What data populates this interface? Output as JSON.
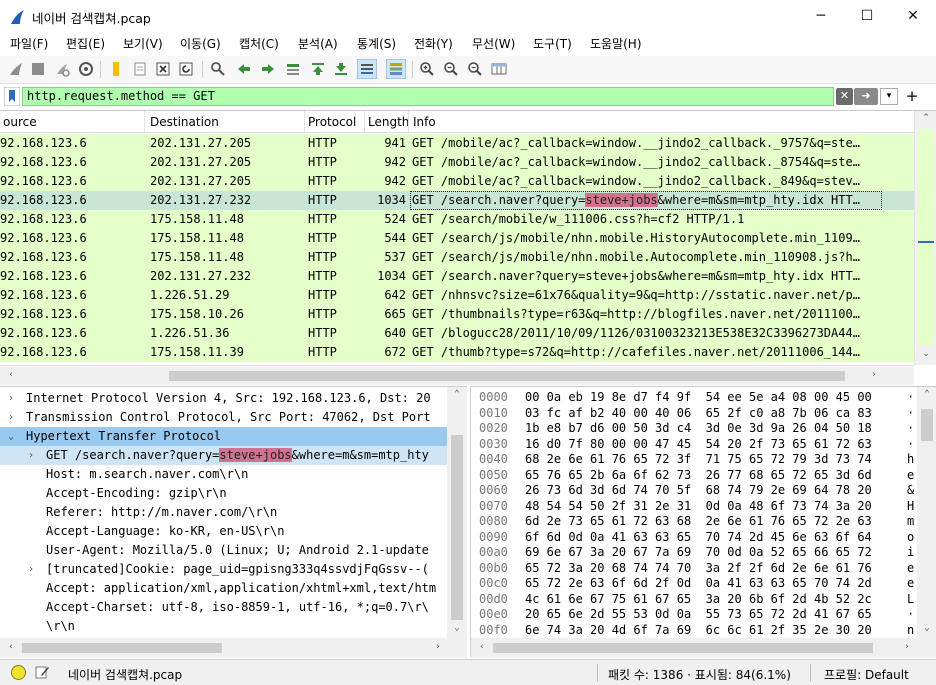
{
  "window": {
    "title": "네이버 검색캡쳐.pcap",
    "minimize_glyph": "─",
    "maximize_glyph": "☐",
    "close_glyph": "✕",
    "icon": "wireshark-fin-icon"
  },
  "menu": [
    "파일(F)",
    "편집(E)",
    "보기(V)",
    "이동(G)",
    "캡처(C)",
    "분석(A)",
    "통계(S)",
    "전화(Y)",
    "무선(W)",
    "도구(T)",
    "도움말(H)"
  ],
  "toolbar_icons": [
    "start-capture-icon",
    "stop-capture-icon",
    "restart-capture-icon",
    "capture-options-icon",
    "open-file-icon",
    "save-file-icon",
    "close-file-icon",
    "reload-file-icon",
    "find-packet-icon",
    "go-back-icon",
    "go-forward-icon",
    "go-to-packet-icon",
    "go-first-icon",
    "go-last-icon",
    "autoscroll-icon",
    "colorize-icon",
    "zoom-in-icon",
    "zoom-out-icon",
    "zoom-normal-icon",
    "resize-columns-icon"
  ],
  "filter": {
    "value": "http.request.method == GET",
    "clear_glyph": "✕",
    "apply_glyph": "➜",
    "dropdown_glyph": "▾",
    "add_glyph": "+"
  },
  "packet_list": {
    "columns": [
      "ource",
      "Destination",
      "Protocol",
      "Length",
      "Info"
    ],
    "rows": [
      {
        "source": "92.168.123.6",
        "destination": "202.131.27.205",
        "protocol": "HTTP",
        "length": "941",
        "info": "GET /mobile/ac?_callback=window.__jindo2_callback._9757&q=ste…",
        "selected": false
      },
      {
        "source": "92.168.123.6",
        "destination": "202.131.27.205",
        "protocol": "HTTP",
        "length": "942",
        "info": "GET /mobile/ac?_callback=window.__jindo2_callback._8754&q=ste…",
        "selected": false
      },
      {
        "source": "92.168.123.6",
        "destination": "202.131.27.205",
        "protocol": "HTTP",
        "length": "942",
        "info": "GET /mobile/ac?_callback=window.__jindo2_callback._849&q=stev…",
        "selected": false
      },
      {
        "source": "92.168.123.6",
        "destination": "202.131.27.232",
        "protocol": "HTTP",
        "length": "1034",
        "info_pre": "GET /search.naver?query=",
        "info_hl": "steve+jobs",
        "info_post": "&where=m&sm=mtp_hty.idx HTT…",
        "selected": true
      },
      {
        "source": "92.168.123.6",
        "destination": "175.158.11.48",
        "protocol": "HTTP",
        "length": "524",
        "info": "GET /search/mobile/w_111006.css?h=cf2 HTTP/1.1",
        "selected": false
      },
      {
        "source": "92.168.123.6",
        "destination": "175.158.11.48",
        "protocol": "HTTP",
        "length": "544",
        "info": "GET /search/js/mobile/nhn.mobile.HistoryAutocomplete.min_1109…",
        "selected": false
      },
      {
        "source": "92.168.123.6",
        "destination": "175.158.11.48",
        "protocol": "HTTP",
        "length": "537",
        "info": "GET /search/js/mobile/nhn.mobile.Autocomplete.min_110908.js?h…",
        "selected": false
      },
      {
        "source": "92.168.123.6",
        "destination": "202.131.27.232",
        "protocol": "HTTP",
        "length": "1034",
        "info": "GET /search.naver?query=steve+jobs&where=m&sm=mtp_hty.idx HTT…",
        "selected": false
      },
      {
        "source": "92.168.123.6",
        "destination": "1.226.51.29",
        "protocol": "HTTP",
        "length": "642",
        "info": "GET /nhnsvc?size=61x76&quality=9&q=http://sstatic.naver.net/p…",
        "selected": false
      },
      {
        "source": "92.168.123.6",
        "destination": "175.158.10.26",
        "protocol": "HTTP",
        "length": "665",
        "info": "GET /thumbnails?type=r63&q=http://blogfiles.naver.net/2011100…",
        "selected": false
      },
      {
        "source": "92.168.123.6",
        "destination": "1.226.51.36",
        "protocol": "HTTP",
        "length": "640",
        "info": "GET /blogucc28/2011/10/09/1126/03100323213E538E32C3396273DA44…",
        "selected": false
      },
      {
        "source": "92.168.123.6",
        "destination": "175.158.11.39",
        "protocol": "HTTP",
        "length": "672",
        "info": "GET /thumb?type=s72&q=http://cafefiles.naver.net/20111006_144…",
        "selected": false
      }
    ]
  },
  "details": {
    "rows": [
      {
        "arrow": "›",
        "indent": 0,
        "text": "Internet Protocol Version 4, Src: 192.168.123.6, Dst: 20",
        "style": ""
      },
      {
        "arrow": "›",
        "indent": 0,
        "text": "Transmission Control Protocol, Src Port: 47062, Dst Port",
        "style": ""
      },
      {
        "arrow": "⌄",
        "indent": 0,
        "text": "Hypertext Transfer Protocol",
        "style": "selhdr"
      },
      {
        "arrow": "›",
        "indent": 1,
        "pre": "GET /search.naver?query=",
        "hl": "steve+jobs",
        "post": "&where=m&sm=mtp_hty",
        "style": "selsub"
      },
      {
        "arrow": "",
        "indent": 1,
        "text": "Host: m.search.naver.com\\r\\n",
        "style": ""
      },
      {
        "arrow": "",
        "indent": 1,
        "text": "Accept-Encoding: gzip\\r\\n",
        "style": ""
      },
      {
        "arrow": "",
        "indent": 1,
        "text": "Referer: http://m.naver.com/\\r\\n",
        "style": ""
      },
      {
        "arrow": "",
        "indent": 1,
        "text": "Accept-Language: ko-KR, en-US\\r\\n",
        "style": ""
      },
      {
        "arrow": "",
        "indent": 1,
        "text": "User-Agent: Mozilla/5.0 (Linux; U; Android 2.1-update",
        "style": ""
      },
      {
        "arrow": "›",
        "indent": 1,
        "text": "[truncated]Cookie: page_uid=gpisng333q4ssvdjFqGssv--(",
        "style": ""
      },
      {
        "arrow": "",
        "indent": 1,
        "text": "Accept: application/xml,application/xhtml+xml,text/htm",
        "style": ""
      },
      {
        "arrow": "",
        "indent": 1,
        "text": "Accept-Charset: utf-8, iso-8859-1, utf-16, *;q=0.7\\r\\",
        "style": ""
      },
      {
        "arrow": "",
        "indent": 1,
        "text": "\\r\\n",
        "style": ""
      }
    ]
  },
  "hex": {
    "rows": [
      {
        "offset": "0000",
        "bytes": "00 0a eb 19 8e d7 f4 9f  54 ee 5e a4 08 00 45 00",
        "ascii": "·"
      },
      {
        "offset": "0010",
        "bytes": "03 fc af b2 40 00 40 06  65 2f c0 a8 7b 06 ca 83",
        "ascii": "·"
      },
      {
        "offset": "0020",
        "bytes": "1b e8 b7 d6 00 50 3d c4  3d 0e 3d 9a 26 04 50 18",
        "ascii": "·"
      },
      {
        "offset": "0030",
        "bytes": "16 d0 7f 80 00 00 47 45  54 20 2f 73 65 61 72 63",
        "ascii": "·"
      },
      {
        "offset": "0040",
        "bytes": "68 2e 6e 61 76 65 72 3f  71 75 65 72 79 3d 73 74",
        "ascii": "h"
      },
      {
        "offset": "0050",
        "bytes": "65 76 65 2b 6a 6f 62 73  26 77 68 65 72 65 3d 6d",
        "ascii": "e"
      },
      {
        "offset": "0060",
        "bytes": "26 73 6d 3d 6d 74 70 5f  68 74 79 2e 69 64 78 20",
        "ascii": "&"
      },
      {
        "offset": "0070",
        "bytes": "48 54 54 50 2f 31 2e 31  0d 0a 48 6f 73 74 3a 20",
        "ascii": "H"
      },
      {
        "offset": "0080",
        "bytes": "6d 2e 73 65 61 72 63 68  2e 6e 61 76 65 72 2e 63",
        "ascii": "m"
      },
      {
        "offset": "0090",
        "bytes": "6f 6d 0d 0a 41 63 63 65  70 74 2d 45 6e 63 6f 64",
        "ascii": "o"
      },
      {
        "offset": "00a0",
        "bytes": "69 6e 67 3a 20 67 7a 69  70 0d 0a 52 65 66 65 72",
        "ascii": "i"
      },
      {
        "offset": "00b0",
        "bytes": "65 72 3a 20 68 74 74 70  3a 2f 2f 6d 2e 6e 61 76",
        "ascii": "e"
      },
      {
        "offset": "00c0",
        "bytes": "65 72 2e 63 6f 6d 2f 0d  0a 41 63 63 65 70 74 2d",
        "ascii": "e"
      },
      {
        "offset": "00d0",
        "bytes": "4c 61 6e 67 75 61 67 65  3a 20 6b 6f 2d 4b 52 2c",
        "ascii": "L"
      },
      {
        "offset": "00e0",
        "bytes": "20 65 6e 2d 55 53 0d 0a  55 73 65 72 2d 41 67 65",
        "ascii": "·"
      },
      {
        "offset": "00f0",
        "bytes": "6e 74 3a 20 4d 6f 7a 69  6c 6c 61 2f 35 2e 30 20",
        "ascii": "n"
      }
    ]
  },
  "status": {
    "file": "네이버 검색캡쳐.pcap",
    "packets": "패킷 수: 1386 · 표시됨: 84(6.1%)",
    "profile": "프로필: Default"
  },
  "colors": {
    "row_bg": "#e4ffc7",
    "row_selected": "#c7e6d6",
    "filter_valid": "#afffaf",
    "highlight": "#d1728f",
    "detail_selected": "#99c9ef"
  }
}
